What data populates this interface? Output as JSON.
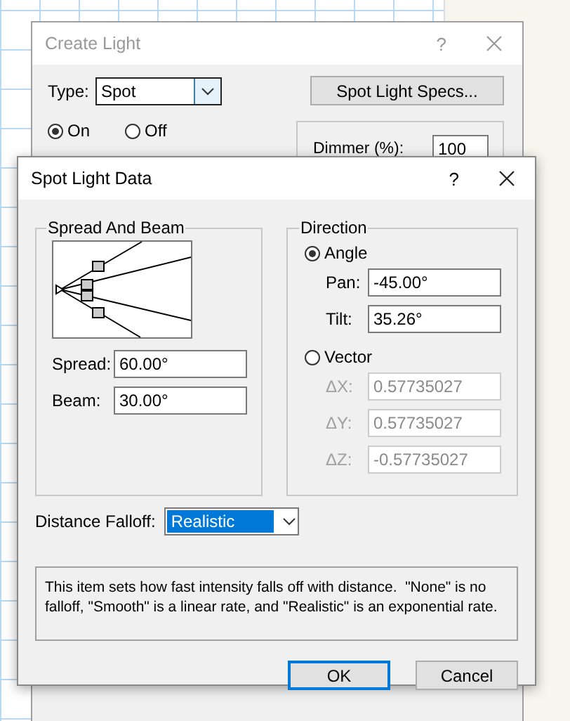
{
  "back_window": {
    "title": "Create Light",
    "help": "?",
    "type_label": "Type:",
    "type_value": "Spot",
    "specs_button": "Spot Light Specs...",
    "power": [
      {
        "label": "On",
        "selected": true
      },
      {
        "label": "Off",
        "selected": false
      }
    ],
    "dimmer_label": "Dimmer (%):",
    "dimmer_value": "100"
  },
  "dialog": {
    "title": "Spot Light Data",
    "help": "?",
    "spread_group": {
      "title": "Spread And Beam",
      "fields": [
        {
          "label": "Spread:",
          "value": "60.00°"
        },
        {
          "label": "Beam:",
          "value": "30.00°"
        }
      ]
    },
    "direction_group": {
      "title": "Direction",
      "modes": [
        {
          "label": "Angle",
          "selected": true,
          "fields": [
            {
              "label": "Pan:",
              "value": "-45.00°",
              "disabled": false
            },
            {
              "label": "Tilt:",
              "value": "35.26°",
              "disabled": false
            }
          ]
        },
        {
          "label": "Vector",
          "selected": false,
          "fields": [
            {
              "label": "ΔX:",
              "value": "0.57735027",
              "disabled": true
            },
            {
              "label": "ΔY:",
              "value": "0.57735027",
              "disabled": true
            },
            {
              "label": "ΔZ:",
              "value": "-0.57735027",
              "disabled": true
            }
          ]
        }
      ]
    },
    "falloff_label": "Distance Falloff:",
    "falloff_value": "Realistic",
    "description": "This item sets how fast intensity falls off with distance.  \"None\" is no falloff, \"Smooth\" is a linear rate, and \"Realistic\" is an exponential rate.",
    "buttons": [
      {
        "label": "OK",
        "default": true
      },
      {
        "label": "Cancel",
        "default": false
      }
    ]
  }
}
